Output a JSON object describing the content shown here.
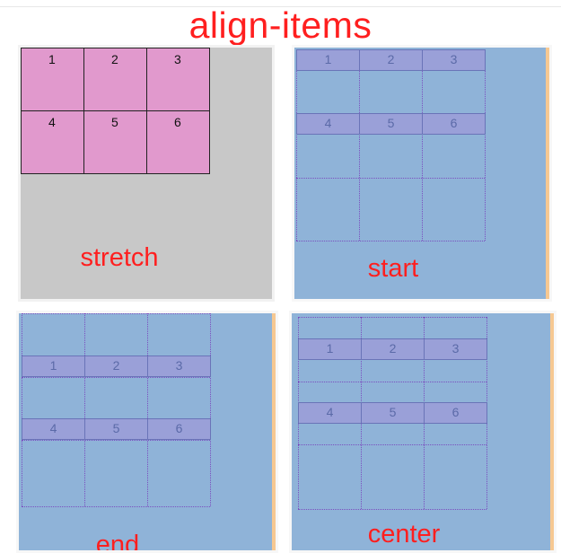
{
  "title": "align-items",
  "cells": [
    "1",
    "2",
    "3",
    "4",
    "5",
    "6"
  ],
  "panels": {
    "stretch": {
      "label": "stretch"
    },
    "start": {
      "label": "start"
    },
    "end": {
      "label": "end"
    },
    "center": {
      "label": "center"
    }
  },
  "colors": {
    "title": "#ff1f1f",
    "stretch_bg": "#c8c8c8",
    "grid_bg": "#8fb3d8",
    "item_pink": "#e199cd",
    "item_blue": "#9aa0d8",
    "accent_bar": "#f6c892"
  }
}
